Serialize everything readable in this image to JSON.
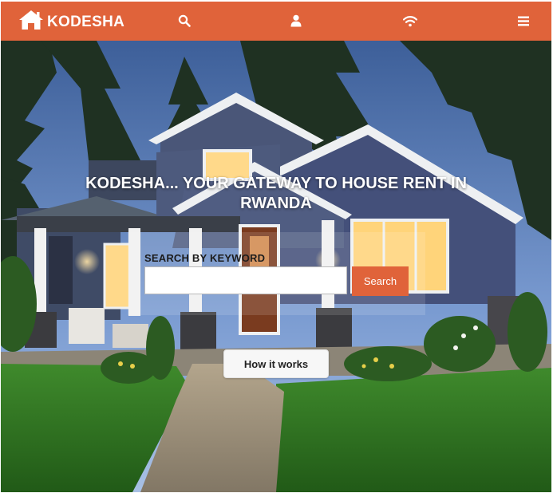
{
  "brand": {
    "name": "KODESHA",
    "icon": "home-icon"
  },
  "nav": {
    "icons": [
      "search-icon",
      "user-icon",
      "wifi-icon",
      "menu-icon"
    ],
    "accent_color": "#e0633a"
  },
  "hero": {
    "headline": "KODESHA... YOUR GATEWAY TO HOUSE RENT IN RWANDA",
    "search_label": "SEARCH BY KEYWORD",
    "search_placeholder": "",
    "search_value": "",
    "search_button": "Search",
    "how_button": "How it works"
  }
}
